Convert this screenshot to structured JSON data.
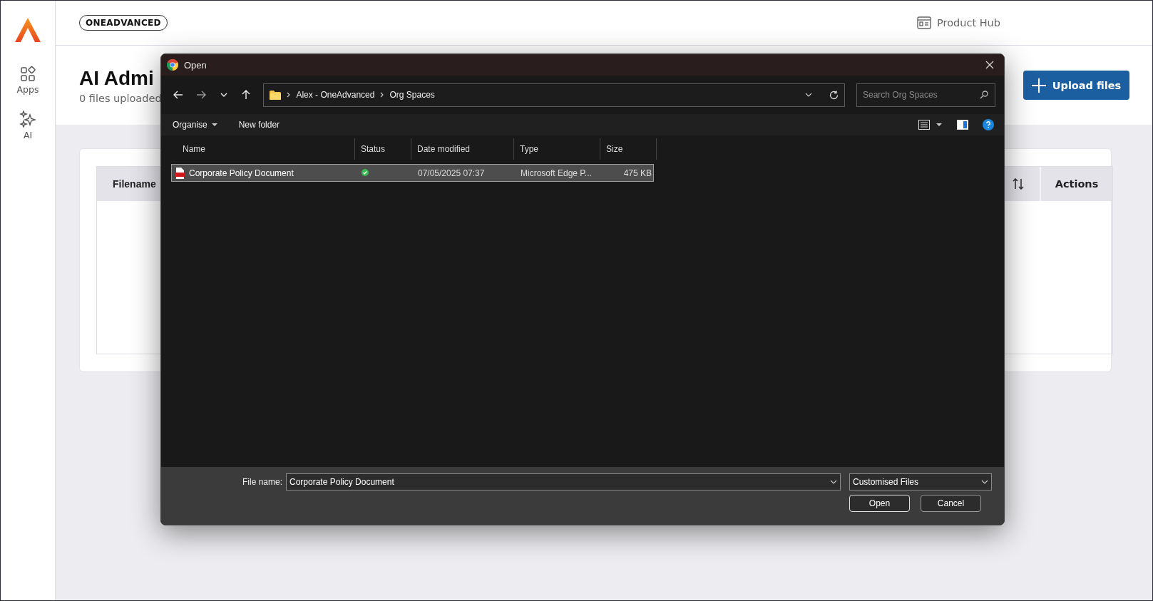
{
  "sidebar": {
    "items": [
      {
        "kind": "apps",
        "label": "Apps"
      },
      {
        "kind": "ai",
        "label": "AI"
      }
    ]
  },
  "header": {
    "brand": "ONEADVANCED",
    "product_hub": "Product Hub"
  },
  "page": {
    "title": "AI Admi",
    "subtitle": "0 files uploaded",
    "upload_button": "Upload files",
    "table": {
      "columns": [
        "Filename",
        "Actions"
      ]
    }
  },
  "dialog": {
    "title": "Open",
    "breadcrumb": [
      "Alex - OneAdvanced",
      "Org Spaces"
    ],
    "search": {
      "placeholder": "Search Org Spaces"
    },
    "toolbar": [
      "Organise",
      "New folder"
    ],
    "columns": [
      "Name",
      "Status",
      "Date modified",
      "Type",
      "Size"
    ],
    "files": [
      {
        "name": "Corporate Policy Document",
        "synced": true,
        "date": "07/05/2025 07:37",
        "type": "Microsoft Edge P...",
        "size": "475 KB",
        "selected": true
      }
    ],
    "file_name": {
      "label": "File name:",
      "value": "Corporate Policy Document"
    },
    "filter": "Customised Files",
    "buttons": [
      "Open",
      "Cancel"
    ]
  }
}
